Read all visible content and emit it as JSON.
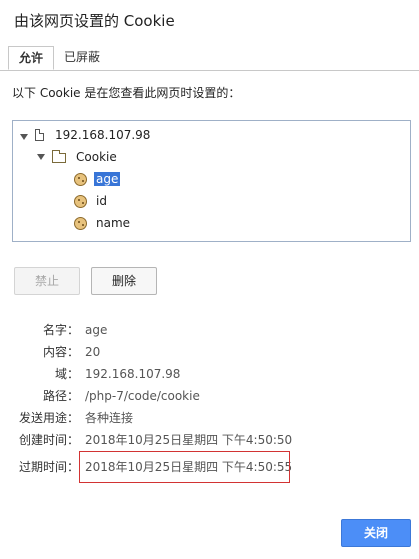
{
  "dialog": {
    "title": "由该网页设置的 Cookie"
  },
  "tabs": [
    {
      "label": "允许"
    },
    {
      "label": "已屏蔽"
    }
  ],
  "intro_text": "以下 Cookie 是在您查看此网页时设置的：",
  "tree": {
    "host": "192.168.107.98",
    "folder": "Cookie",
    "cookies": [
      {
        "name": "age",
        "selected": true
      },
      {
        "name": "id",
        "selected": false
      },
      {
        "name": "name",
        "selected": false
      }
    ]
  },
  "buttons": {
    "block": "禁止",
    "delete": "删除",
    "close": "关闭"
  },
  "details": [
    {
      "label": "名字：",
      "value": "age"
    },
    {
      "label": "内容：",
      "value": "20"
    },
    {
      "label": "域：",
      "value": "192.168.107.98"
    },
    {
      "label": "路径：",
      "value": "/php-7/code/cookie"
    },
    {
      "label": "发送用途：",
      "value": "各种连接"
    },
    {
      "label": "创建时间：",
      "value": "2018年10月25日星期四 下午4:50:50"
    },
    {
      "label": "过期时间：",
      "value": "2018年10月25日星期四 下午4:50:55"
    }
  ],
  "colors": {
    "accent": "#4c8ef7",
    "selection": "#3875d7",
    "highlight_border": "#d23333"
  }
}
